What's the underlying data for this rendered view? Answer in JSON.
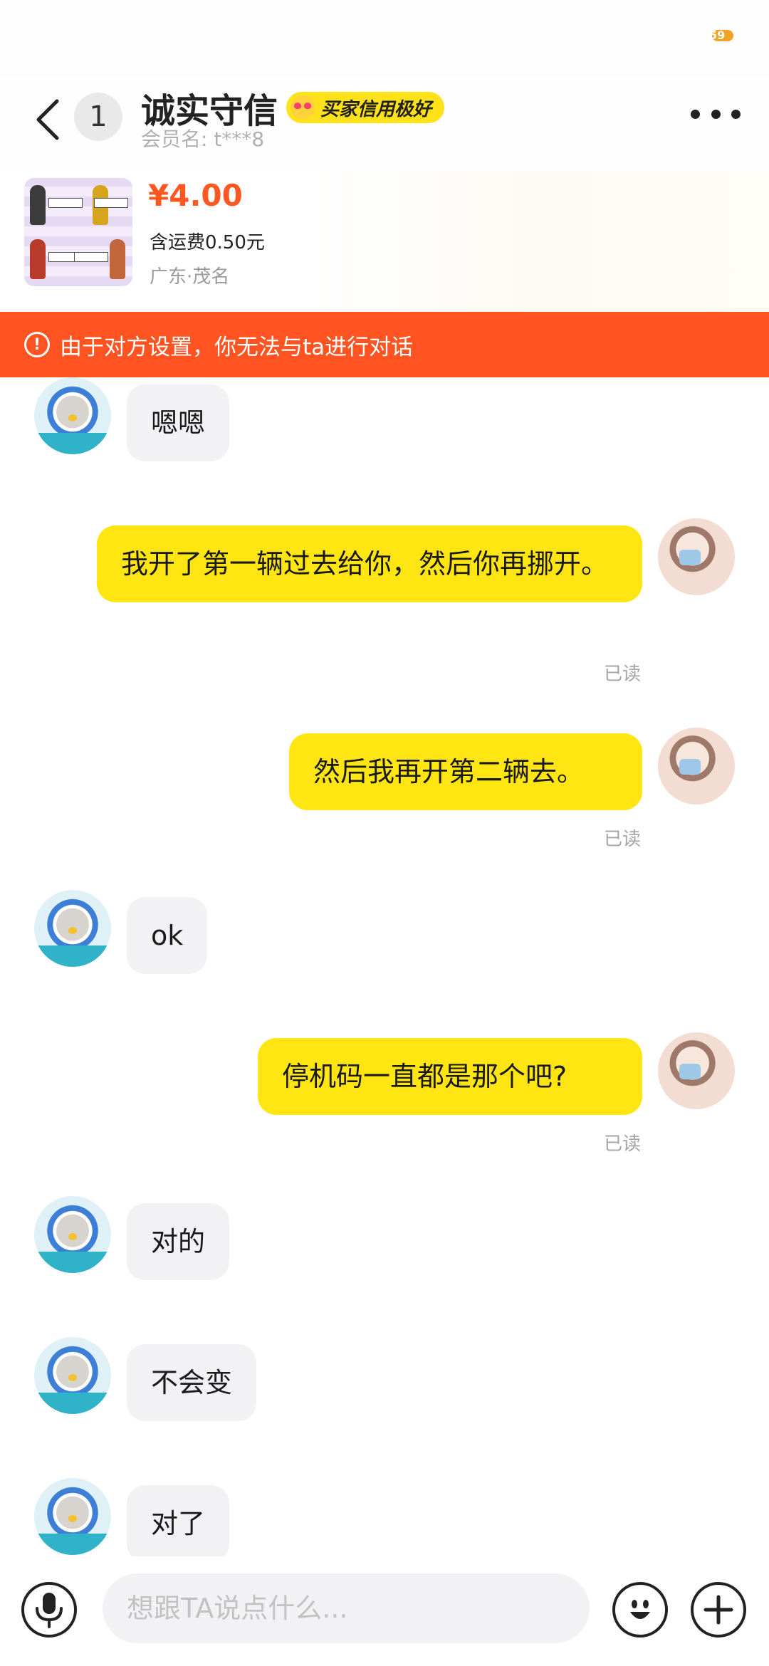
{
  "status": {
    "battery_label": "59"
  },
  "header": {
    "unread_count": "1",
    "title": "诚实守信",
    "credit_tag": "买家信用极好",
    "member_label": "会员名: t***8"
  },
  "product": {
    "price": "¥4.00",
    "shipping": "含运费0.50元",
    "location": "广东·茂名"
  },
  "banner": {
    "text": "由于对方设置，你无法与ta进行对话"
  },
  "messages": [
    {
      "side": "in",
      "text": "嗯嗯"
    },
    {
      "side": "out",
      "text": "我开了第一辆过去给你，然后你再挪开。",
      "status": "已读"
    },
    {
      "side": "out",
      "text": "然后我再开第二辆去。",
      "status": "已读"
    },
    {
      "side": "in",
      "text": "ok"
    },
    {
      "side": "out",
      "text": "停机码一直都是那个吧?",
      "status": "已读"
    },
    {
      "side": "in",
      "text": "对的"
    },
    {
      "side": "in",
      "text": "不会变"
    },
    {
      "side": "in",
      "text": "对了"
    }
  ],
  "input": {
    "placeholder": "想跟TA说点什么..."
  },
  "icons": {
    "back": "chevron-left-icon",
    "more": "more-dots-icon",
    "warning": "warning-circle-icon",
    "mic": "microphone-icon",
    "emoji": "emoji-face-icon",
    "plus": "plus-icon"
  },
  "colors": {
    "outgoing_bubble": "#ffe612",
    "incoming_bubble": "#f2f2f4",
    "banner": "#ff5422",
    "price": "#ff5722",
    "credit_tag": "#ffe21a"
  }
}
